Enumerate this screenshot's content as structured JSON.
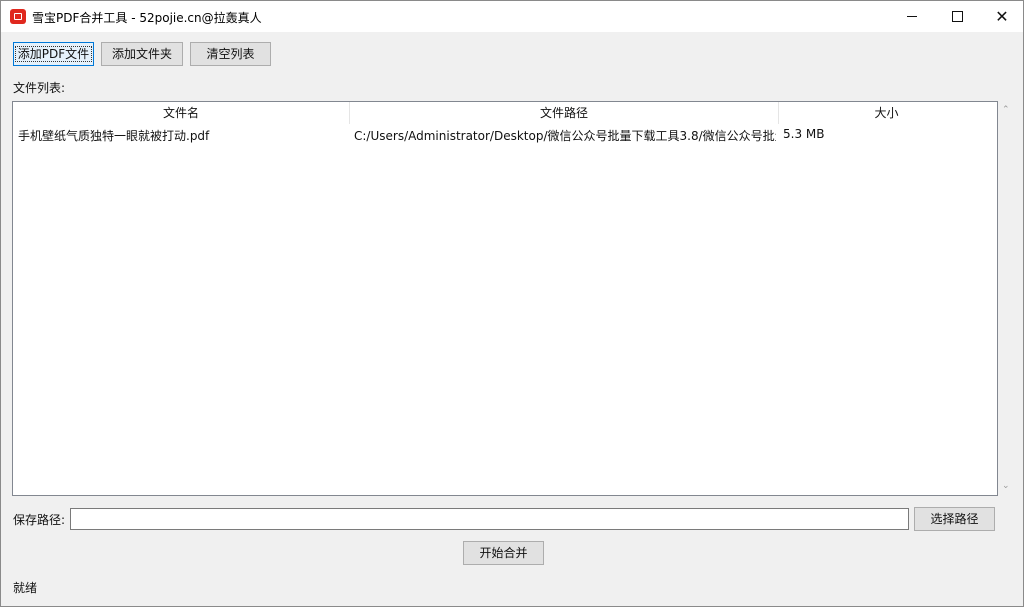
{
  "window": {
    "title": "雪宝PDF合并工具 - 52pojie.cn@拉轰真人"
  },
  "toolbar": {
    "add_pdf_label": "添加PDF文件",
    "add_folder_label": "添加文件夹",
    "clear_list_label": "清空列表"
  },
  "list": {
    "label": "文件列表:",
    "columns": [
      "文件名",
      "文件路径",
      "大小"
    ],
    "rows": [
      {
        "name": "手机壁纸气质独特一眼就被打动.pdf",
        "path": "C:/Users/Administrator/Desktop/微信公众号批量下载工具3.8/微信公众号批量下",
        "size": "5.3 MB"
      }
    ]
  },
  "save": {
    "label": "保存路径:",
    "value": "",
    "browse_label": "选择路径"
  },
  "actions": {
    "start_label": "开始合并"
  },
  "status": {
    "text": "就绪"
  },
  "icons": {
    "app": "app-pdf-icon",
    "minimize": "minimize-icon",
    "maximize": "maximize-icon",
    "close": "close-icon",
    "scroll_up": "chevron-up-icon",
    "scroll_down": "chevron-down-icon"
  },
  "colors": {
    "app_icon": "#e0281e",
    "focus": "#0078d7"
  }
}
